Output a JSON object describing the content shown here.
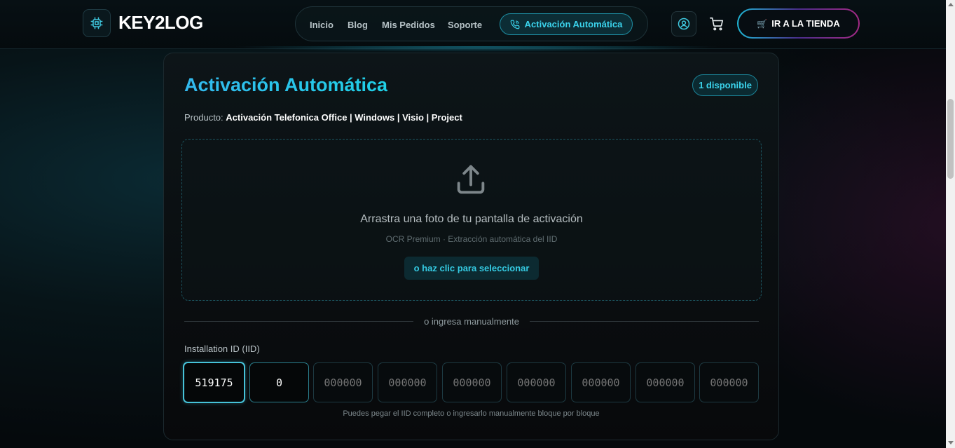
{
  "header": {
    "logo_text": "KEY2LOG",
    "nav": [
      {
        "label": "Inicio"
      },
      {
        "label": "Blog"
      },
      {
        "label": "Mis Pedidos"
      },
      {
        "label": "Soporte"
      }
    ],
    "nav_active_label": "Activación Automática",
    "store_button": "IR A LA TIENDA"
  },
  "card": {
    "title": "Activación Automática",
    "badge": "1 disponible",
    "product_prefix": "Producto:",
    "product_name": "Activación Telefonica Office | Windows | Visio | Project",
    "dropzone": {
      "title": "Arrastra una foto de tu pantalla de activación",
      "subtitle": "OCR Premium · Extracción automática del IID",
      "button": "o haz clic para seleccionar"
    },
    "divider": "o ingresa manualmente",
    "iid_label": "Installation ID (IID)",
    "iid_blocks": [
      {
        "value": "519175",
        "placeholder": "000000"
      },
      {
        "value": "0",
        "placeholder": "000000"
      },
      {
        "value": "",
        "placeholder": "000000"
      },
      {
        "value": "",
        "placeholder": "000000"
      },
      {
        "value": "",
        "placeholder": "000000"
      },
      {
        "value": "",
        "placeholder": "000000"
      },
      {
        "value": "",
        "placeholder": "000000"
      },
      {
        "value": "",
        "placeholder": "000000"
      },
      {
        "value": "",
        "placeholder": "000000"
      }
    ],
    "iid_help": "Puedes pegar el IID completo o ingresarlo manualmente bloque por bloque"
  },
  "colors": {
    "accent": "#3bd3ec",
    "background": "#05090c"
  },
  "icons": [
    "chip-icon",
    "phone-icon",
    "user-icon",
    "cart-icon",
    "upload-icon"
  ]
}
